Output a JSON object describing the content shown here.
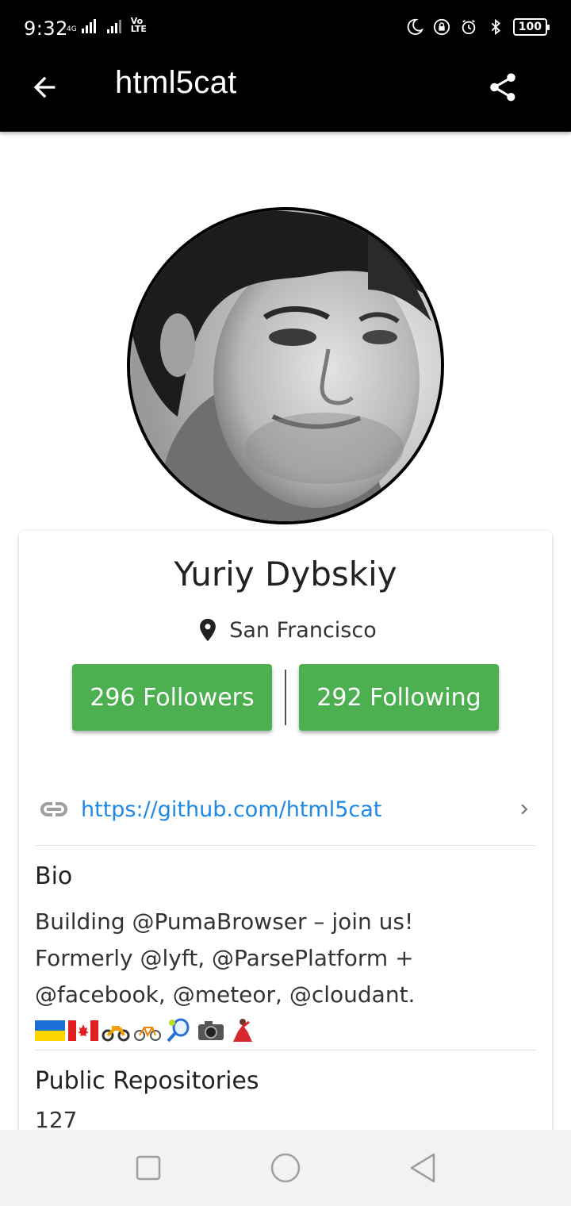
{
  "status_bar": {
    "time": "9:32",
    "network_4g": "4G",
    "volte_vo": "Vo",
    "volte_lte": "LTE",
    "battery": "100"
  },
  "app_bar": {
    "title": "html5cat"
  },
  "profile": {
    "name": "Yuriy Dybskiy",
    "location": "San Francisco",
    "followers_label": "296 Followers",
    "following_label": "292 Following",
    "link": "https://github.com/html5cat",
    "bio_title": "Bio",
    "bio_lines": [
      "Building @PumaBrowser – join us!",
      "Formerly @lyft, @ParsePlatform +",
      "@facebook, @meteor, @cloudant."
    ],
    "emojis": [
      "flag-ukraine",
      "flag-canada",
      "motorcycle",
      "bicycle",
      "tennis",
      "camera",
      "dancer"
    ],
    "repos_title": "Public Repositories",
    "repos_count": "127"
  },
  "colors": {
    "accent_green": "#4caf50",
    "link_blue": "#1e88e5",
    "bar_black": "#000000"
  }
}
